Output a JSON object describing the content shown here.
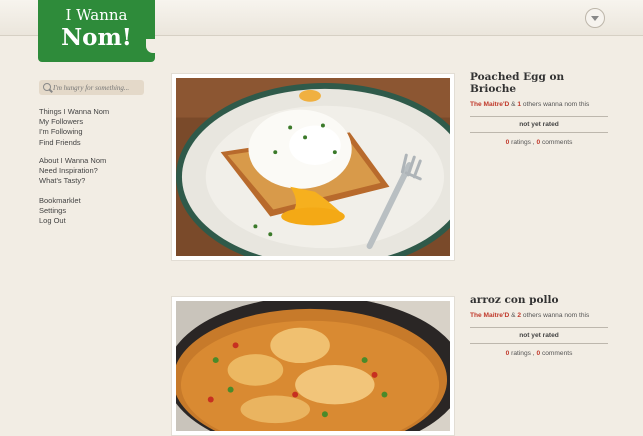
{
  "logo": {
    "line1": "I Wanna",
    "line2": "Nom!"
  },
  "search": {
    "placeholder": "I'm hungry for something..."
  },
  "nav": {
    "group1": [
      "Things I Wanna Nom",
      "My Followers",
      "I'm Following",
      "Find Friends"
    ],
    "group2": [
      "About I Wanna Nom",
      "Need Inspiration?",
      "What's Tasty?"
    ],
    "group3": [
      "Bookmarklet",
      "Settings",
      "Log Out"
    ]
  },
  "posts": [
    {
      "title": "Poached Egg on Brioche",
      "author": "The Maitre'D",
      "amp": "&",
      "others_count": "1",
      "others_text": "others wanna nom this",
      "rating_status": "not yet rated",
      "ratings_count": "0",
      "ratings_label": "ratings ,",
      "comments_count": "0",
      "comments_label": "comments"
    },
    {
      "title": "arroz con pollo",
      "author": "The Maitre'D",
      "amp": "&",
      "others_count": "2",
      "others_text": "others wanna nom this",
      "rating_status": "not yet rated",
      "ratings_count": "0",
      "ratings_label": "ratings ,",
      "comments_count": "0",
      "comments_label": "comments"
    }
  ],
  "colors": {
    "brand_green": "#2e8b3a",
    "accent_red": "#c0392b",
    "page_bg": "#f2ede4"
  },
  "icons": [
    "menu-dropdown-icon",
    "search-icon"
  ]
}
